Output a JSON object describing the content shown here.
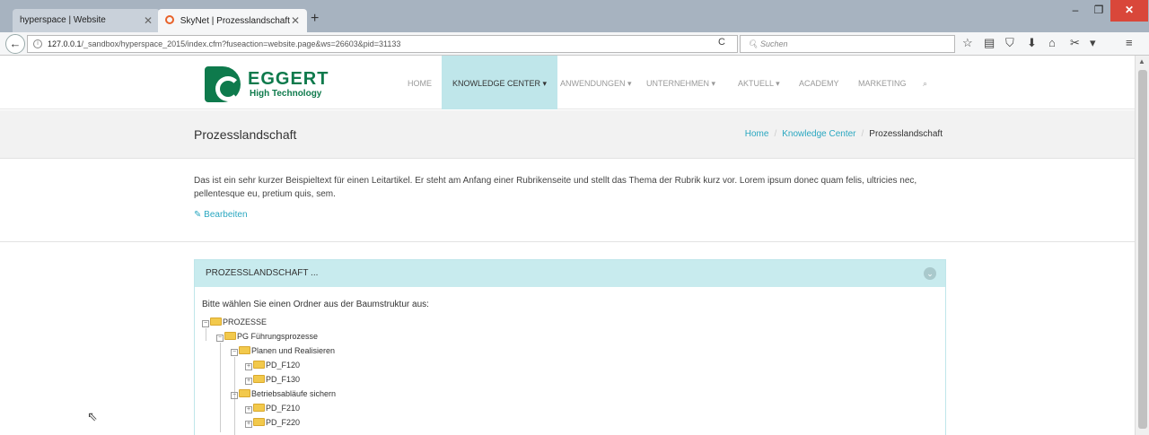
{
  "browser": {
    "tabs": [
      {
        "title": "hyperspace | Website",
        "active": false
      },
      {
        "title": "SkyNet | Prozesslandschaft",
        "active": true
      }
    ],
    "url_host": "127.0.0.1",
    "url_path": "/_sandbox/hyperspace_2015/index.cfm?fuseaction=website.page&ws=26603&pid=31133",
    "search_placeholder": "Suchen"
  },
  "site": {
    "logo_name": "EGGERT",
    "logo_tagline": "High Technology",
    "menu": [
      {
        "label": "HOME",
        "active": false
      },
      {
        "label": "KNOWLEDGE CENTER ▾",
        "active": true
      },
      {
        "label": "ANWENDUNGEN ▾",
        "active": false
      },
      {
        "label": "UNTERNEHMEN ▾",
        "active": false
      },
      {
        "label": "AKTUELL ▾",
        "active": false
      },
      {
        "label": "ACADEMY",
        "active": false
      },
      {
        "label": "MARKETING",
        "active": false
      }
    ]
  },
  "page": {
    "title": "Prozesslandschaft",
    "breadcrumb": [
      "Home",
      "Knowledge Center",
      "Prozesslandschaft"
    ],
    "intro": "Das ist ein sehr kurzer Beispieltext für einen Leitartikel. Er steht am Anfang einer Rubrikenseite und stellt das Thema der Rubrik kurz vor. Lorem ipsum donec quam felis, ultricies nec, pellentesque eu, pretium quis, sem.",
    "edit_label": "Bearbeiten"
  },
  "panel": {
    "header": "PROZESSLANDSCHAFT ...",
    "intro": "Bitte wählen Sie einen Ordner aus der Baumstruktur aus:",
    "tree": [
      {
        "label": "PROZESSE",
        "level": 0
      },
      {
        "label": "PG Führungsprozesse",
        "level": 1
      },
      {
        "label": "Planen und Realisieren",
        "level": 2
      },
      {
        "label": "PD_F120",
        "level": 3
      },
      {
        "label": "PD_F130",
        "level": 3
      },
      {
        "label": "Betriebsabläufe sichern",
        "level": 2
      },
      {
        "label": "PD_F210",
        "level": 3
      },
      {
        "label": "PD_F220",
        "level": 3
      }
    ]
  }
}
